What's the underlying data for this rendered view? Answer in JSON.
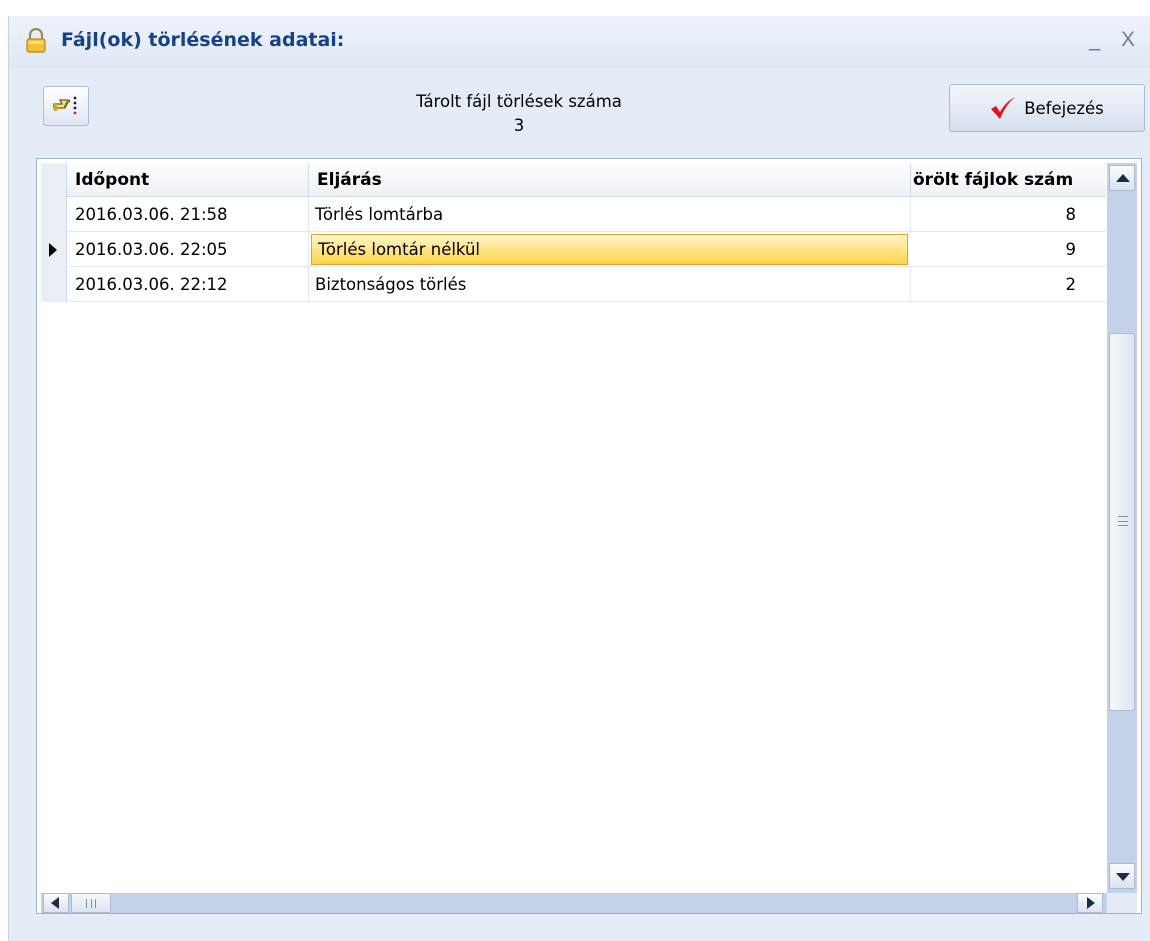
{
  "window": {
    "title": "Fájl(ok) törlésének adatai:",
    "minimize_label": "_",
    "close_label": "X"
  },
  "toolbar": {
    "summary_label": "Tárolt fájl törlések száma",
    "summary_count": "3",
    "finish_label": "Befejezés"
  },
  "grid": {
    "columns": [
      "Időpont",
      "Eljárás",
      "örölt fájlok szám"
    ],
    "rows": [
      {
        "time": "2016.03.06. 21:58",
        "method": "Törlés lomtárba",
        "count": "8",
        "current": false
      },
      {
        "time": "2016.03.06. 22:05",
        "method": "Törlés lomtár nélkül",
        "count": "9",
        "current": true
      },
      {
        "time": "2016.03.06. 22:12",
        "method": "Biztonságos törlés",
        "count": "2",
        "current": false
      }
    ]
  },
  "icons": {
    "title": "lock-icon",
    "tool": "pointing-hand-icon",
    "finish": "checkmark-icon"
  },
  "colors": {
    "title_text": "#15428b",
    "selection_fill": "#ffd54a",
    "check_red": "#e0141e",
    "scroll_track": "#c3d2e8"
  }
}
